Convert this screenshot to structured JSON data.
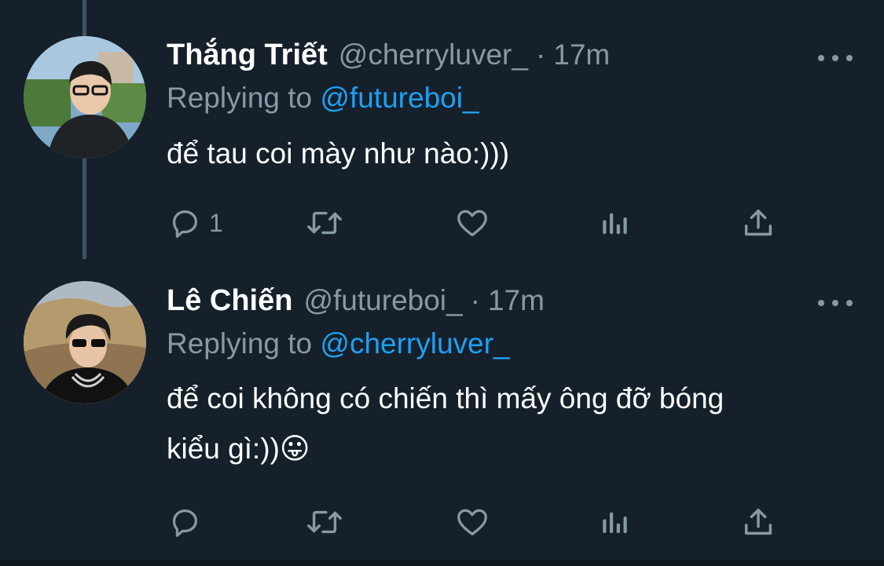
{
  "tweets": [
    {
      "display_name": "Thắng Triết",
      "handle": "@cherryluver_",
      "separator": "·",
      "time": "17m",
      "replying_prefix": "Replying to",
      "replying_to": "@futureboi_",
      "text_lines": [
        "để tau coi mày như nào:)))"
      ],
      "reply_count": "1",
      "more_icon": "more-horizontal-icon"
    },
    {
      "display_name": "Lê Chiến",
      "handle": "@futureboi_",
      "separator": "·",
      "time": "17m",
      "replying_prefix": "Replying to",
      "replying_to": "@cherryluver_",
      "text_lines": [
        "để coi không có chiến thì mấy ông đỡ bóng",
        "kiểu gì:))😛"
      ],
      "reply_count": "",
      "more_icon": "more-horizontal-icon"
    }
  ],
  "icons": {
    "reply": "reply-icon",
    "retweet": "retweet-icon",
    "like": "heart-icon",
    "analytics": "analytics-icon",
    "share": "share-icon"
  },
  "colors": {
    "background": "#15202b",
    "secondary_text": "#8899a6",
    "link": "#1da1f2",
    "thread_line": "#3d5466"
  }
}
